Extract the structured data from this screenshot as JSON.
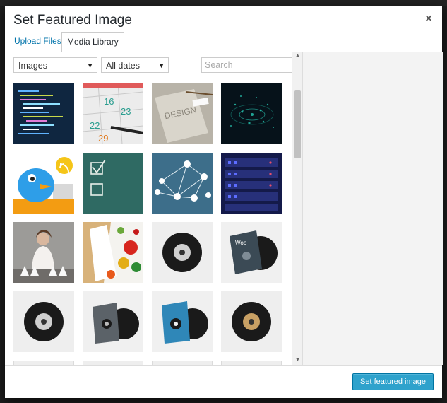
{
  "modal": {
    "title": "Set Featured Image",
    "close_glyph": "×"
  },
  "tabs": [
    {
      "label": "Upload Files",
      "active": false
    },
    {
      "label": "Media Library",
      "active": true
    }
  ],
  "filters": {
    "type_selected": "Images",
    "date_selected": "All dates",
    "search_placeholder": "Search"
  },
  "media_items": [
    {
      "name": "code-screen"
    },
    {
      "name": "calendar-pen"
    },
    {
      "name": "notebook-design"
    },
    {
      "name": "digital-tunnel"
    },
    {
      "name": "bird-laptop"
    },
    {
      "name": "chalkboard-checklist"
    },
    {
      "name": "social-network-globe"
    },
    {
      "name": "server-rack"
    },
    {
      "name": "woman-cups"
    },
    {
      "name": "vegetables-board"
    },
    {
      "name": "vinyl-record-black"
    },
    {
      "name": "vinyl-sleeve-woo"
    },
    {
      "name": "vinyl-record-black-2"
    },
    {
      "name": "vinyl-sleeve-gray"
    },
    {
      "name": "vinyl-sleeve-blue"
    },
    {
      "name": "vinyl-record-gold"
    }
  ],
  "footer": {
    "primary_button": "Set featured image"
  },
  "colors": {
    "accent": "#0073aa",
    "button": "#2ea2cc"
  }
}
